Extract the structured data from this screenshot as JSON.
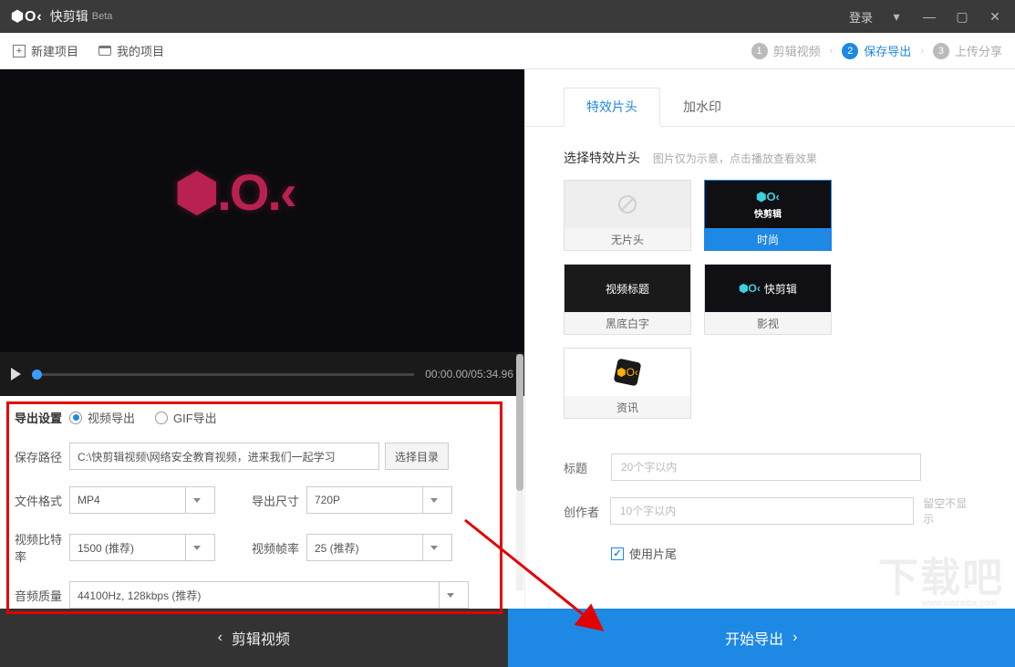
{
  "titlebar": {
    "app_name": "快剪辑",
    "beta": "Beta",
    "login": "登录"
  },
  "toolbar": {
    "new_project": "新建项目",
    "my_projects": "我的项目"
  },
  "steps": {
    "s1": "剪辑视频",
    "s2": "保存导出",
    "s3": "上传分享"
  },
  "player": {
    "time": "00:00.00/05:34.96"
  },
  "export": {
    "title": "导出设置",
    "radio_video": "视频导出",
    "radio_gif": "GIF导出",
    "path_label": "保存路径",
    "path_value": "C:\\快剪辑视频\\网络安全教育视频，进来我们一起学习",
    "browse": "选择目录",
    "format_label": "文件格式",
    "format_value": "MP4",
    "size_label": "导出尺寸",
    "size_value": "720P",
    "bitrate_label": "视频比特率",
    "bitrate_value": "1500 (推荐)",
    "fps_label": "视频帧率",
    "fps_value": "25 (推荐)",
    "audio_label": "音频质量",
    "audio_value": "44100Hz, 128kbps (推荐)"
  },
  "right": {
    "tab_effect": "特效片头",
    "tab_watermark": "加水印",
    "section_title": "选择特效片头",
    "section_hint": "图片仅为示意，点击播放查看效果",
    "thumbs": {
      "none": "无片头",
      "fashion": "时尚",
      "black": "黑底白字",
      "black_text": "视频标题",
      "movie": "影视",
      "movie_text": "快剪辑",
      "news": "资讯"
    },
    "title_label": "标题",
    "title_ph": "20个字以内",
    "author_label": "创作者",
    "author_ph": "10个字以内",
    "author_hint": "留空不显示",
    "use_tail": "使用片尾"
  },
  "bottom": {
    "back": "剪辑视频",
    "start": "开始导出"
  },
  "watermark": "下载吧"
}
